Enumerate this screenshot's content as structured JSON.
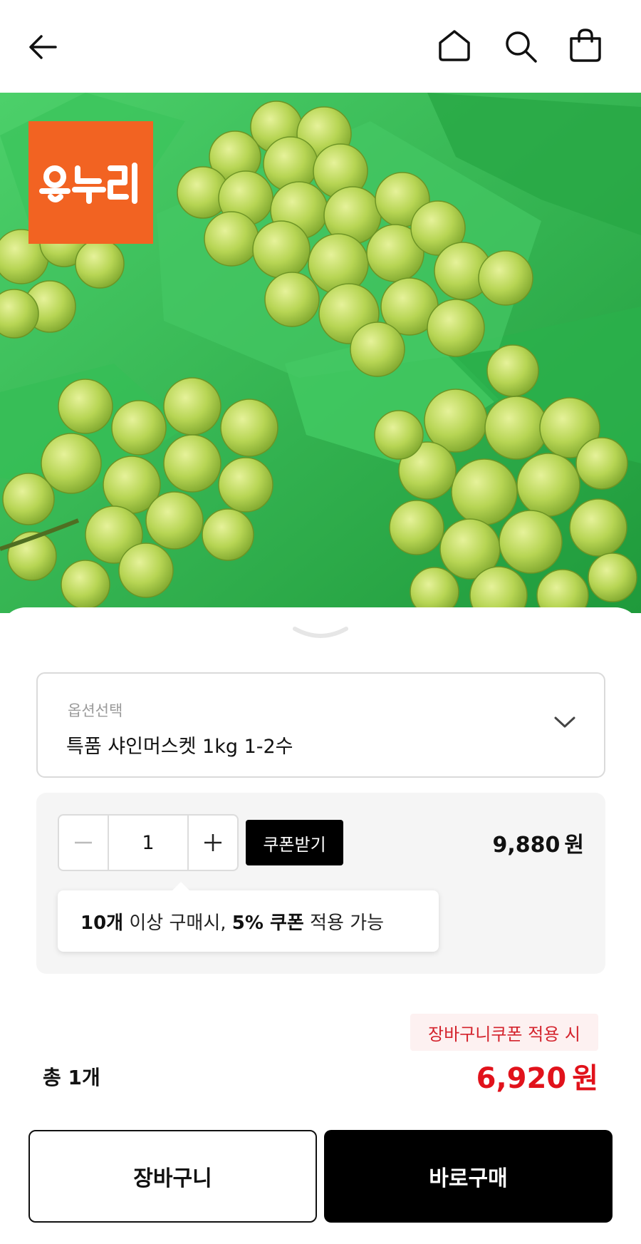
{
  "header": {
    "back_icon": "arrow-left-icon",
    "home_icon": "home-icon",
    "search_icon": "search-icon",
    "bag_icon": "shopping-bag-icon"
  },
  "hero": {
    "logo_text": "온누리",
    "logo_color": "#f26322",
    "subject": "shine-muscat-grapes"
  },
  "option": {
    "label": "옵션선택",
    "selected": "특품 샤인머스켓 1kg 1-2수"
  },
  "quantity": {
    "minus_icon": "minus-icon",
    "value": "1",
    "plus_icon": "plus-icon",
    "coupon_button": "쿠폰받기",
    "price": "9,880",
    "price_unit": "원"
  },
  "tooltip": {
    "bold_1": "10개",
    "text_1": " 이상 구매시, ",
    "bold_2": "5% 쿠폰",
    "text_2": " 적용 가능"
  },
  "summary": {
    "coupon_tag": "장바구니쿠폰 적용 시",
    "total_count": "총 1개",
    "total_price": "6,920",
    "total_unit": "원"
  },
  "actions": {
    "cart_label": "장바구니",
    "buy_label": "바로구매"
  },
  "colors": {
    "accent_red": "#e1121b",
    "primary_black": "#000000"
  }
}
